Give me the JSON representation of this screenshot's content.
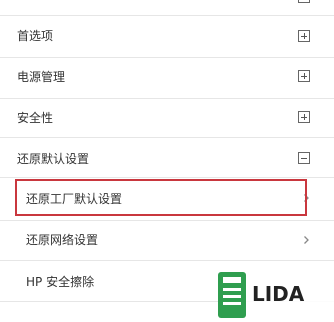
{
  "menu": {
    "items": [
      {
        "label": "首选项",
        "indicator": "expand"
      },
      {
        "label": "电源管理",
        "indicator": "expand"
      },
      {
        "label": "安全性",
        "indicator": "expand"
      },
      {
        "label": "还原默认设置",
        "indicator": "collapse"
      }
    ],
    "submenu": [
      {
        "label": "还原工厂默认设置",
        "selected": true
      },
      {
        "label": "还原网络设置",
        "selected": false
      },
      {
        "label": "HP 安全擦除",
        "selected": false
      }
    ]
  },
  "colors": {
    "highlight": "#c9373e",
    "logo_green": "#2f9e4f"
  },
  "watermark": {
    "text": "LIDA"
  }
}
